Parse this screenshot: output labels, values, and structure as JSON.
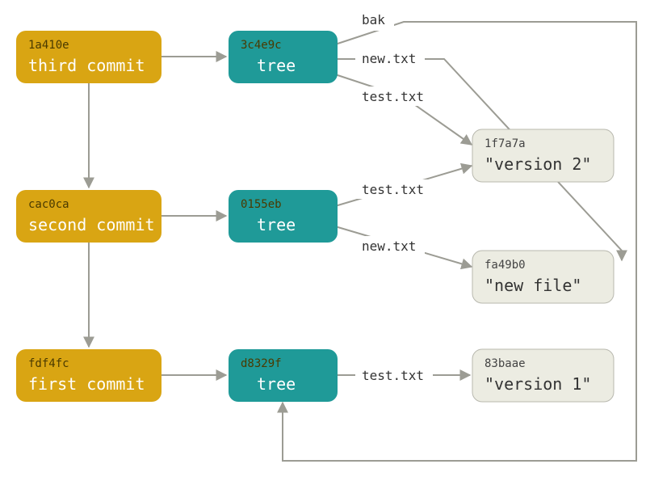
{
  "chart_data": {
    "type": "object-graph",
    "commits": [
      {
        "sha": "1a410e",
        "label": "third commit",
        "tree": "3c4e9c",
        "parent": "cac0ca"
      },
      {
        "sha": "cac0ca",
        "label": "second commit",
        "tree": "0155eb",
        "parent": "fdf4fc"
      },
      {
        "sha": "fdf4fc",
        "label": "first commit",
        "tree": "d8329f",
        "parent": null
      }
    ],
    "trees": [
      {
        "sha": "3c4e9c",
        "entries": [
          {
            "name": "bak",
            "target_tree": "d8329f"
          },
          {
            "name": "new.txt",
            "target_blob": "fa49b0"
          },
          {
            "name": "test.txt",
            "target_blob": "1f7a7a"
          }
        ]
      },
      {
        "sha": "0155eb",
        "entries": [
          {
            "name": "test.txt",
            "target_blob": "1f7a7a"
          },
          {
            "name": "new.txt",
            "target_blob": "fa49b0"
          }
        ]
      },
      {
        "sha": "d8329f",
        "entries": [
          {
            "name": "test.txt",
            "target_blob": "83baae"
          }
        ]
      }
    ],
    "blobs": [
      {
        "sha": "1f7a7a",
        "content": "\"version 2\""
      },
      {
        "sha": "fa49b0",
        "content": "\"new file\""
      },
      {
        "sha": "83baae",
        "content": "\"version 1\""
      }
    ],
    "tree_label": "tree"
  },
  "colors": {
    "commit": "#d9a513",
    "tree": "#1f9a98",
    "blob_bg": "#ecece2",
    "blob_border": "#b8b8ae",
    "edge": "#9c9c94"
  }
}
